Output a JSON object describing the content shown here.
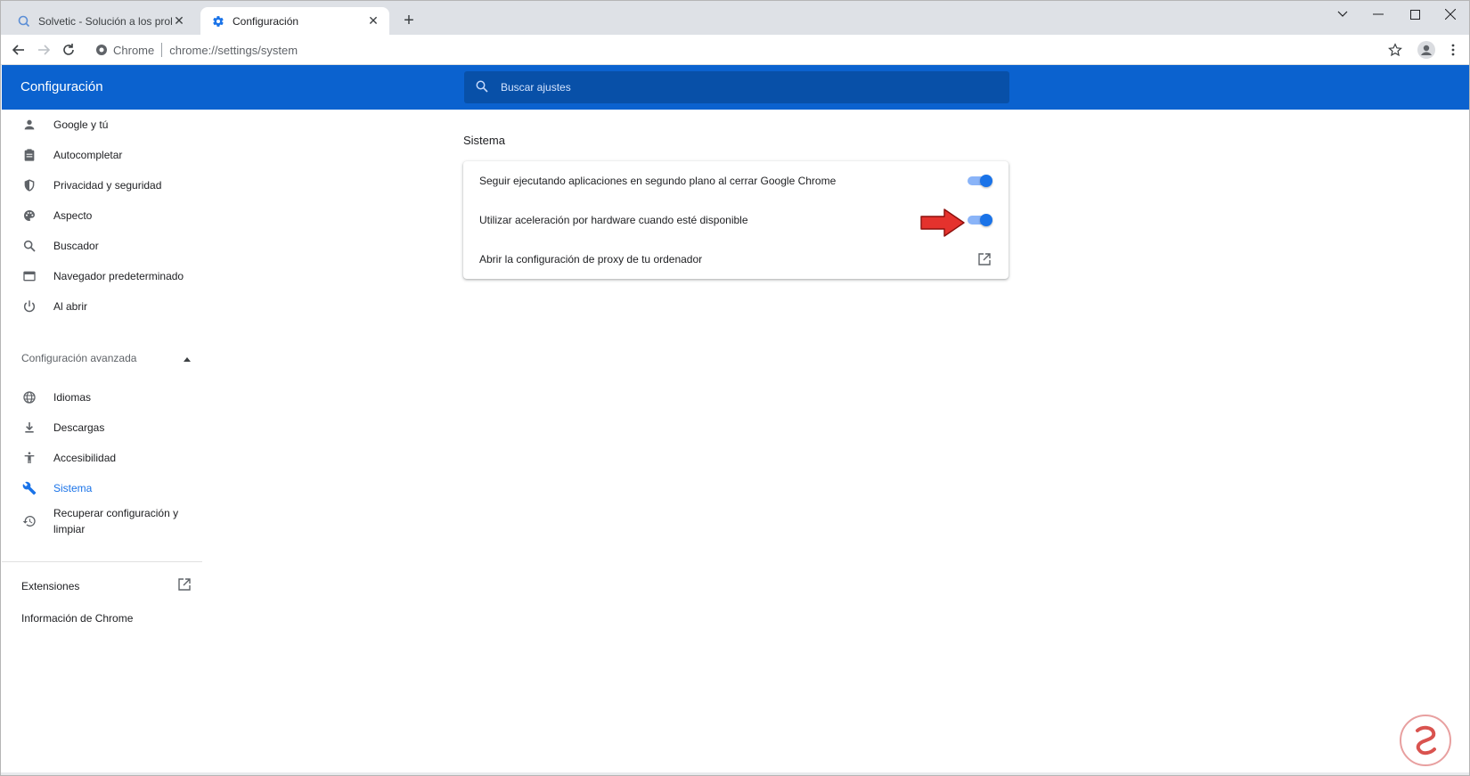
{
  "browser": {
    "tabs": [
      {
        "title": "Solvetic - Solución a los problem",
        "active": false
      },
      {
        "title": "Configuración",
        "active": true
      }
    ],
    "address": {
      "chip": "Chrome",
      "url": "chrome://settings/system"
    }
  },
  "header": {
    "title": "Configuración",
    "search_placeholder": "Buscar ajustes"
  },
  "sidebar": {
    "items": [
      {
        "label": "Google y tú",
        "icon": "person-icon"
      },
      {
        "label": "Autocompletar",
        "icon": "clipboard-icon"
      },
      {
        "label": "Privacidad y seguridad",
        "icon": "shield-icon"
      },
      {
        "label": "Aspecto",
        "icon": "palette-icon"
      },
      {
        "label": "Buscador",
        "icon": "search-icon"
      },
      {
        "label": "Navegador predeterminado",
        "icon": "browser-icon"
      },
      {
        "label": "Al abrir",
        "icon": "power-icon"
      }
    ],
    "advanced_label": "Configuración avanzada",
    "advanced_items": [
      {
        "label": "Idiomas",
        "icon": "globe-icon"
      },
      {
        "label": "Descargas",
        "icon": "download-icon"
      },
      {
        "label": "Accesibilidad",
        "icon": "accessibility-icon"
      },
      {
        "label": "Sistema",
        "icon": "wrench-icon",
        "selected": true
      },
      {
        "label": "Recuperar configuración y limpiar",
        "icon": "restore-icon"
      }
    ],
    "extensions_label": "Extensiones",
    "about_label": "Información de Chrome"
  },
  "main": {
    "section_title": "Sistema",
    "rows": [
      {
        "label": "Seguir ejecutando aplicaciones en segundo plano al cerrar Google Chrome",
        "control": "toggle",
        "on": true
      },
      {
        "label": "Utilizar aceleración por hardware cuando esté disponible",
        "control": "toggle",
        "on": true
      },
      {
        "label": "Abrir la configuración de proxy de tu ordenador",
        "control": "external-link"
      }
    ]
  },
  "colors": {
    "header_blue": "#0b62cf",
    "search_bg": "#0850a8",
    "accent": "#1a73e8",
    "toggle_track": "#8ab4f8",
    "annotation_arrow": "#e5322d"
  }
}
